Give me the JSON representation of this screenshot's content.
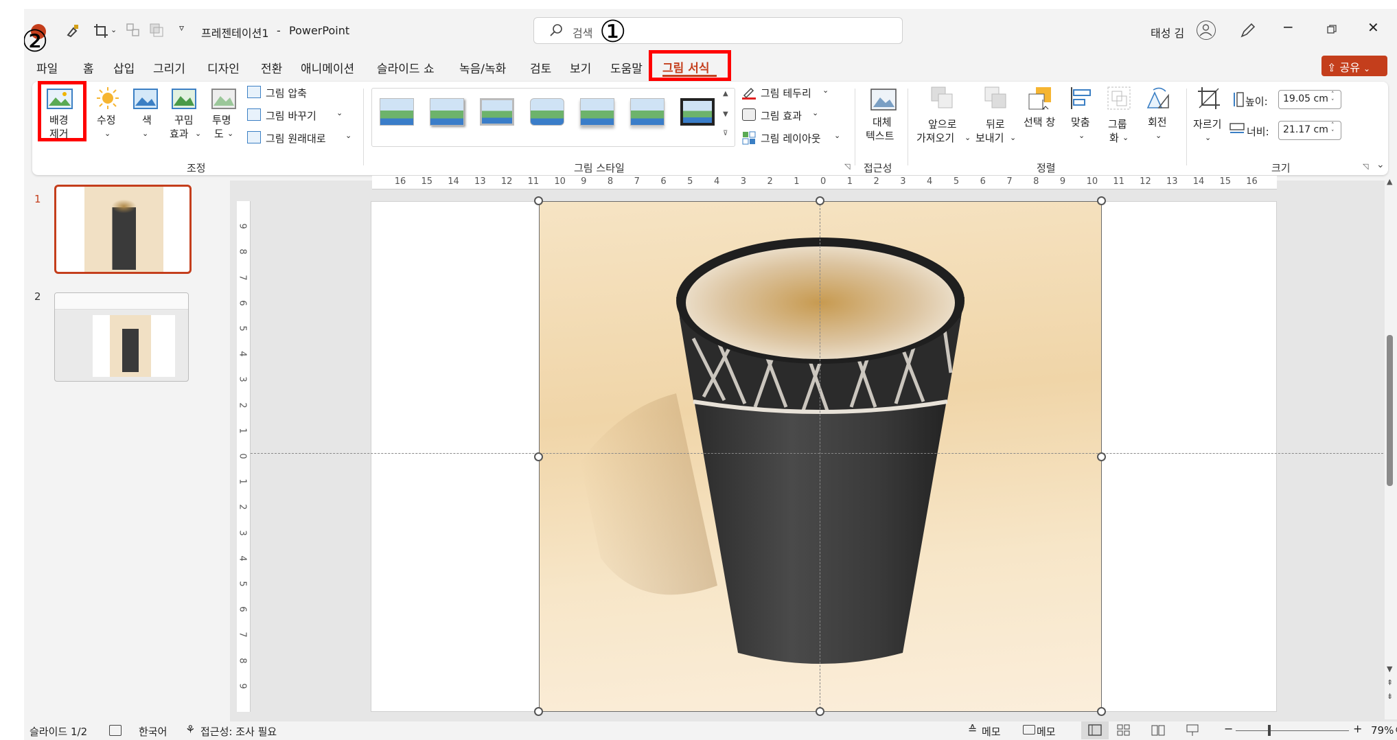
{
  "titlebar": {
    "doc_title": "프레젠테이션1",
    "dash": "-",
    "app_name": "PowerPoint",
    "search_placeholder": "검색",
    "user_name": "태성 김"
  },
  "annotations": {
    "step1": "①",
    "step2": "②"
  },
  "tabs": [
    "파일",
    "홈",
    "삽입",
    "그리기",
    "디자인",
    "전환",
    "애니메이션",
    "슬라이드 쇼",
    "녹음/녹화",
    "검토",
    "보기",
    "도움말",
    "그림 서식"
  ],
  "share_label": "공유",
  "ribbon": {
    "adjust": {
      "bg_remove_l1": "배경",
      "bg_remove_l2": "제거",
      "corrections": "수정",
      "color": "색",
      "artistic_l1": "꾸밈",
      "artistic_l2": "효과",
      "transparency_l1": "투명",
      "transparency_l2": "도",
      "compress": "그림 압축",
      "change": "그림 바꾸기",
      "reset": "그림 원래대로",
      "group_label": "조정"
    },
    "styles": {
      "border": "그림 테두리",
      "effects": "그림 효과",
      "layout": "그림 레이아웃",
      "group_label": "그림 스타일"
    },
    "accessibility": {
      "alt_l1": "대체",
      "alt_l2": "텍스트",
      "group_label": "접근성"
    },
    "arrange": {
      "forward_l1": "앞으로",
      "forward_l2": "가져오기",
      "backward_l1": "뒤로",
      "backward_l2": "보내기",
      "selection_pane": "선택 창",
      "align": "맞춤",
      "group_l1": "그룹",
      "group_l2": "화",
      "rotate": "회전",
      "group_label": "정렬"
    },
    "size": {
      "crop": "자르기",
      "height_label": "높이:",
      "height_value": "19.05 cm",
      "width_label": "너비:",
      "width_value": "21.17 cm",
      "group_label": "크기"
    }
  },
  "thumbnails": [
    {
      "number": "1"
    },
    {
      "number": "2"
    }
  ],
  "ruler_h": [
    "16",
    "15",
    "14",
    "13",
    "12",
    "11",
    "10",
    "9",
    "8",
    "7",
    "6",
    "5",
    "4",
    "3",
    "2",
    "1",
    "0",
    "1",
    "2",
    "3",
    "4",
    "5",
    "6",
    "7",
    "8",
    "9",
    "10",
    "11",
    "12",
    "13",
    "14",
    "15",
    "16"
  ],
  "ruler_v": [
    "9",
    "8",
    "7",
    "6",
    "5",
    "4",
    "3",
    "2",
    "1",
    "0",
    "1",
    "2",
    "3",
    "4",
    "5",
    "6",
    "7",
    "8",
    "9"
  ],
  "status": {
    "slide": "슬라이드 1/2",
    "language": "한국어",
    "accessibility": "접근성: 조사 필요",
    "notes": "메모",
    "comments": "메모",
    "zoom": "79%",
    "minus": "−",
    "plus": "+"
  },
  "colors": {
    "accent": "#c43e1c",
    "highlight": "#ff0000"
  }
}
